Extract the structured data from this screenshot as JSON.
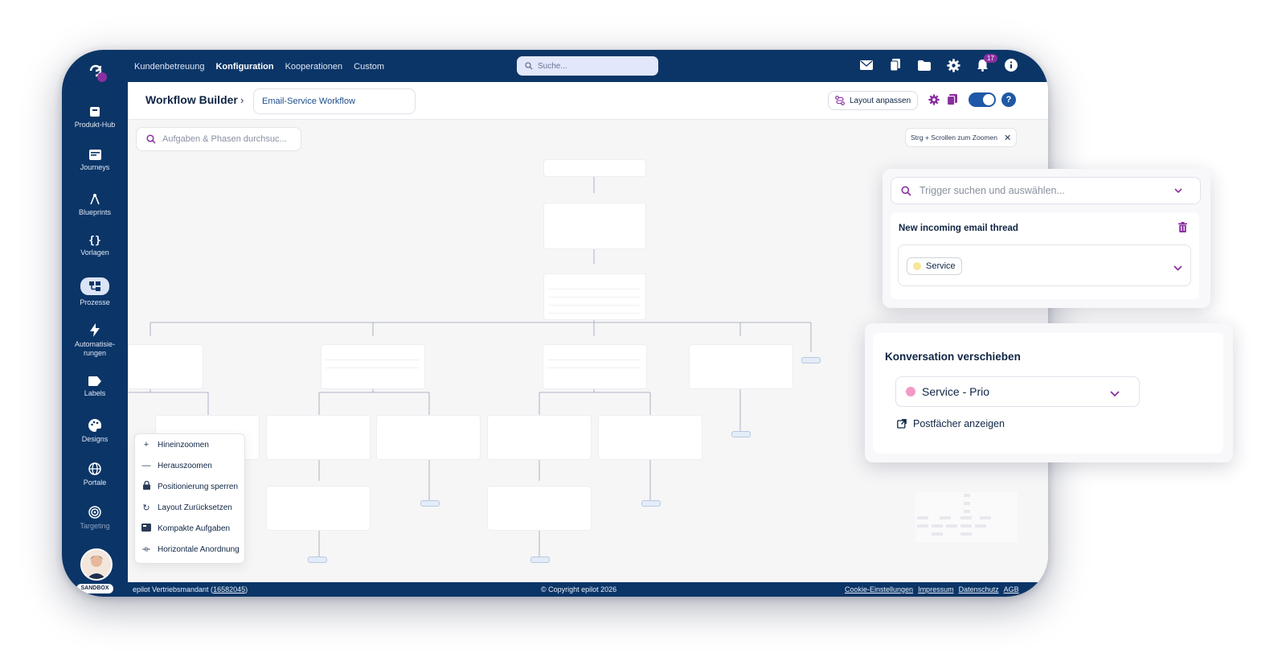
{
  "topbar": {
    "nav": [
      "Kundenbetreuung",
      "Konfiguration",
      "Kooperationen",
      "Custom"
    ],
    "active_nav": "Konfiguration",
    "search_placeholder": "Suche...",
    "notification_count": "17",
    "icons": [
      "mail-icon",
      "copy-icon",
      "folder-icon",
      "gear-icon",
      "bell-icon",
      "info-icon"
    ]
  },
  "sidebar": {
    "items": [
      {
        "label": "Produkt-Hub",
        "icon": "box-icon"
      },
      {
        "label": "Journeys",
        "icon": "journey-icon"
      },
      {
        "label": "Blueprints",
        "icon": "compass-icon"
      },
      {
        "label": "Vorlagen",
        "icon": "braces-icon"
      },
      {
        "label": "Prozesse",
        "icon": "process-icon"
      },
      {
        "label": "Automatisie-",
        "label2": "rungen",
        "icon": "bolt-icon"
      },
      {
        "label": "Labels",
        "icon": "label-icon"
      },
      {
        "label": "Designs",
        "icon": "palette-icon"
      },
      {
        "label": "Portale",
        "icon": "globe-icon"
      },
      {
        "label": "Targeting",
        "icon": "target-icon"
      }
    ],
    "active": "Prozesse",
    "sandbox": "SANDBOX"
  },
  "header": {
    "title": "Workflow Builder",
    "workflow_name": "Email-Service Workflow",
    "layout_button": "Layout anpassen",
    "help": "?"
  },
  "canvas": {
    "search_placeholder": "Aufgaben & Phasen durchsuc...",
    "zoom_hint": "Strg + Scrollen zum Zoomen",
    "menu": [
      {
        "label": "Hineinzoomen",
        "glyph": "+"
      },
      {
        "label": "Herauszoomen",
        "glyph": "—"
      },
      {
        "label": "Positionierung sperren",
        "glyph": "🔒"
      },
      {
        "label": "Layout Zurücksetzen",
        "glyph": "↻"
      },
      {
        "label": "Kompakte Aufgaben",
        "glyph": "▰"
      },
      {
        "label": "Horizontale Anordnung",
        "glyph": "⟛"
      }
    ]
  },
  "footer": {
    "tenant": "epilot Vertriebsmandant (",
    "tenant_id": "16582045",
    "tenant_end": ")",
    "copyright": "© Copyright epilot 2026",
    "links": [
      "Cookie-Einstellungen",
      "Impressum",
      "Datenschutz",
      "AGB"
    ]
  },
  "trigger_panel": {
    "search_placeholder": "Trigger suchen und auswählen...",
    "trigger_title": "New incoming email thread",
    "chip_label": "Service",
    "chip_color": "#f6e79a"
  },
  "move_panel": {
    "title": "Konversation verschieben",
    "selected": "Service - Prio",
    "selected_color": "#f29ac3",
    "link": "Postfächer anzeigen"
  },
  "colors": {
    "navy": "#0b3567",
    "accent_purple": "#8a2fa0",
    "accent_blue": "#1f58a6"
  }
}
